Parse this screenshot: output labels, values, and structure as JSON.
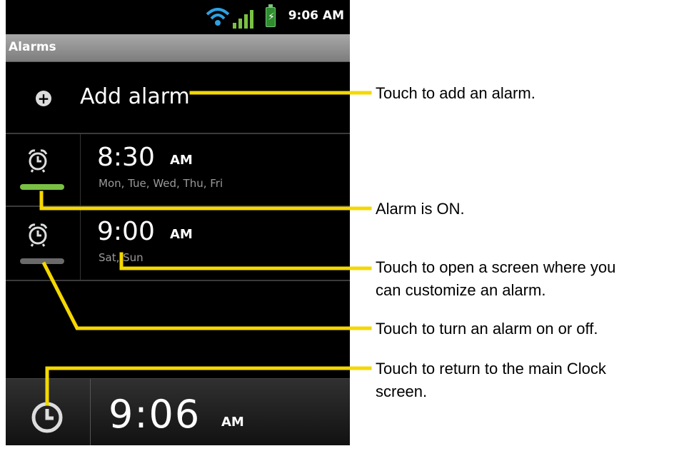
{
  "status_bar": {
    "time": "9:06 AM",
    "icons": [
      "wifi-icon",
      "signal-icon",
      "battery-charging-icon"
    ]
  },
  "title_bar": {
    "title": "Alarms"
  },
  "add_alarm": {
    "label": "Add alarm",
    "icon": "add-icon"
  },
  "alarms": [
    {
      "time": "8:30",
      "ampm": "AM",
      "days": "Mon, Tue, Wed, Thu, Fri",
      "enabled": true,
      "indicator_color": "#7ac143"
    },
    {
      "time": "9:00",
      "ampm": "AM",
      "days": "Sat, Sun",
      "enabled": false,
      "indicator_color": "#6a6a6a"
    }
  ],
  "bottom_bar": {
    "time": "9:06",
    "ampm": "AM",
    "icon": "clock-icon"
  },
  "annotations": {
    "add": "Touch to add an alarm.",
    "alarm_on": "Alarm is ON.",
    "customize_line1": "Touch to open a screen where you",
    "customize_line2": "can customize an alarm.",
    "toggle": "Touch to turn an alarm on or off.",
    "return_line1": "Touch to return to the main Clock",
    "return_line2": "screen."
  },
  "colors": {
    "leader": "#f5d800",
    "alarm_on": "#7ac143",
    "alarm_off": "#6a6a6a"
  }
}
